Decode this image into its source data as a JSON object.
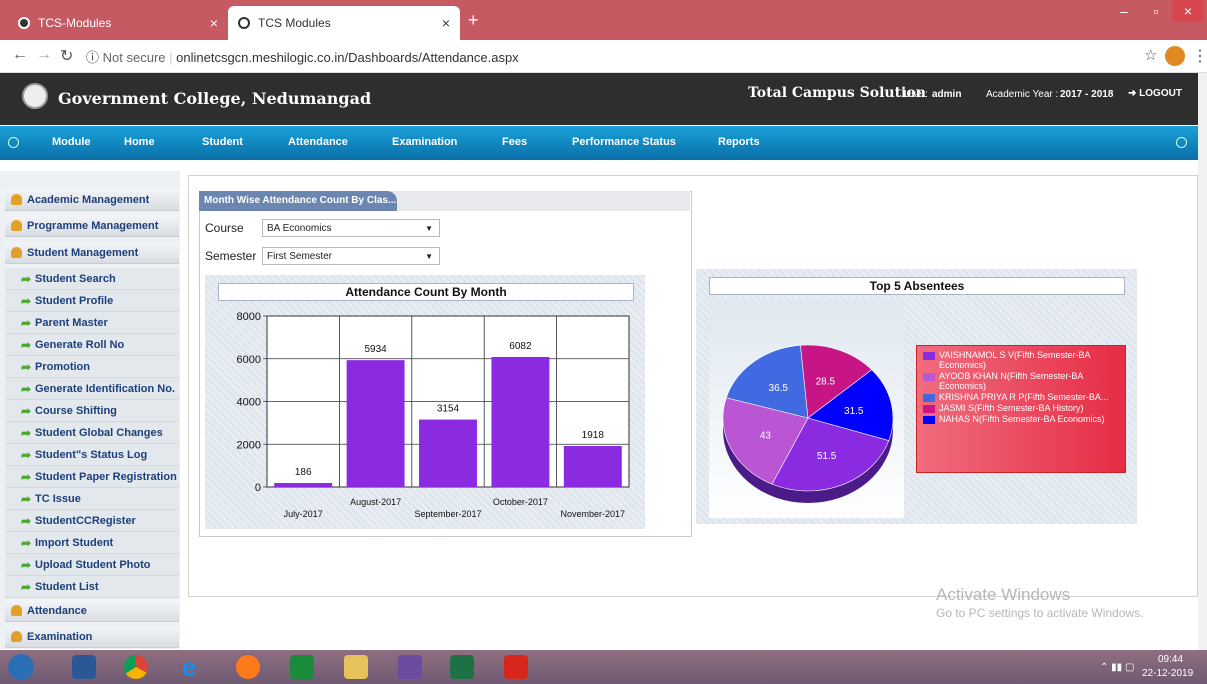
{
  "browser": {
    "tabs": [
      {
        "label": "TCS-Modules"
      },
      {
        "label": "TCS Modules"
      }
    ],
    "url_secure_label": "Not secure",
    "url_text": "onlinetcsgcn.meshilogic.co.in/Dashboards/Attendance.aspx"
  },
  "header": {
    "college": "Government College, Nedumangad",
    "system": "Total Campus Solution",
    "user_label": "User:",
    "user": "admin",
    "year_label": "Academic Year :",
    "year": "2017 - 2018",
    "logout": "LOGOUT"
  },
  "menu": {
    "items": [
      "Module",
      "Home",
      "Student",
      "Attendance",
      "Examination",
      "Fees",
      "Performance Status",
      "Reports"
    ]
  },
  "sidebar": {
    "sections": [
      {
        "label": "Academic Management"
      },
      {
        "label": "Programme Management"
      },
      {
        "label": "Student Management"
      }
    ],
    "items": [
      "Student Search",
      "Student Profile",
      "Parent Master",
      "Generate Roll No",
      "Promotion",
      "Generate Identification No.",
      "Course Shifting",
      "Student Global Changes",
      "Student\"s Status Log",
      "Student Paper Registration",
      "TC Issue",
      "StudentCCRegister",
      "Import Student",
      "Upload Student Photo",
      "Student List"
    ],
    "bottom_sections": [
      {
        "label": "Attendance"
      },
      {
        "label": "Examination"
      }
    ]
  },
  "filters": {
    "title": "Month Wise Attendance Count By Clas...",
    "course_label": "Course",
    "course_value": "BA Economics",
    "semester_label": "Semester",
    "semester_value": "First Semester"
  },
  "chart_data": [
    {
      "type": "bar",
      "title": "Attendance Count By Month",
      "categories": [
        "July-2017",
        "August-2017",
        "September-2017",
        "October-2017",
        "November-2017"
      ],
      "values": [
        186,
        5934,
        3154,
        6082,
        1918
      ],
      "ylim": [
        0,
        8000
      ],
      "yticks": [
        0,
        2000,
        4000,
        6000,
        8000
      ],
      "color": "#8a2be2"
    },
    {
      "type": "pie",
      "title": "Top 5 Absentees",
      "series": [
        {
          "name": "VAISHNAMOL S V(Fifth Semester-BA Economics)",
          "value": 51.5,
          "color": "#8a2be2"
        },
        {
          "name": "AYOOB KHAN N(Fifth Semester-BA Economics)",
          "value": 43,
          "color": "#ba55d3"
        },
        {
          "name": "KRISHNA PRIYA R P(Fifth Semester-BA...",
          "value": 36.5,
          "color": "#4169e1"
        },
        {
          "name": "JASMI S(Fifth Semester-BA History)",
          "value": 28.5,
          "color": "#c71585"
        },
        {
          "name": "NAHAS N(Fifth Semester-BA Economics)",
          "value": 31.5,
          "color": "#0000ff"
        }
      ]
    }
  ],
  "watermark": {
    "line1": "Activate Windows",
    "line2": "Go to PC settings to activate Windows."
  },
  "taskbar": {
    "time": "09:44",
    "date": "22-12-2019"
  }
}
